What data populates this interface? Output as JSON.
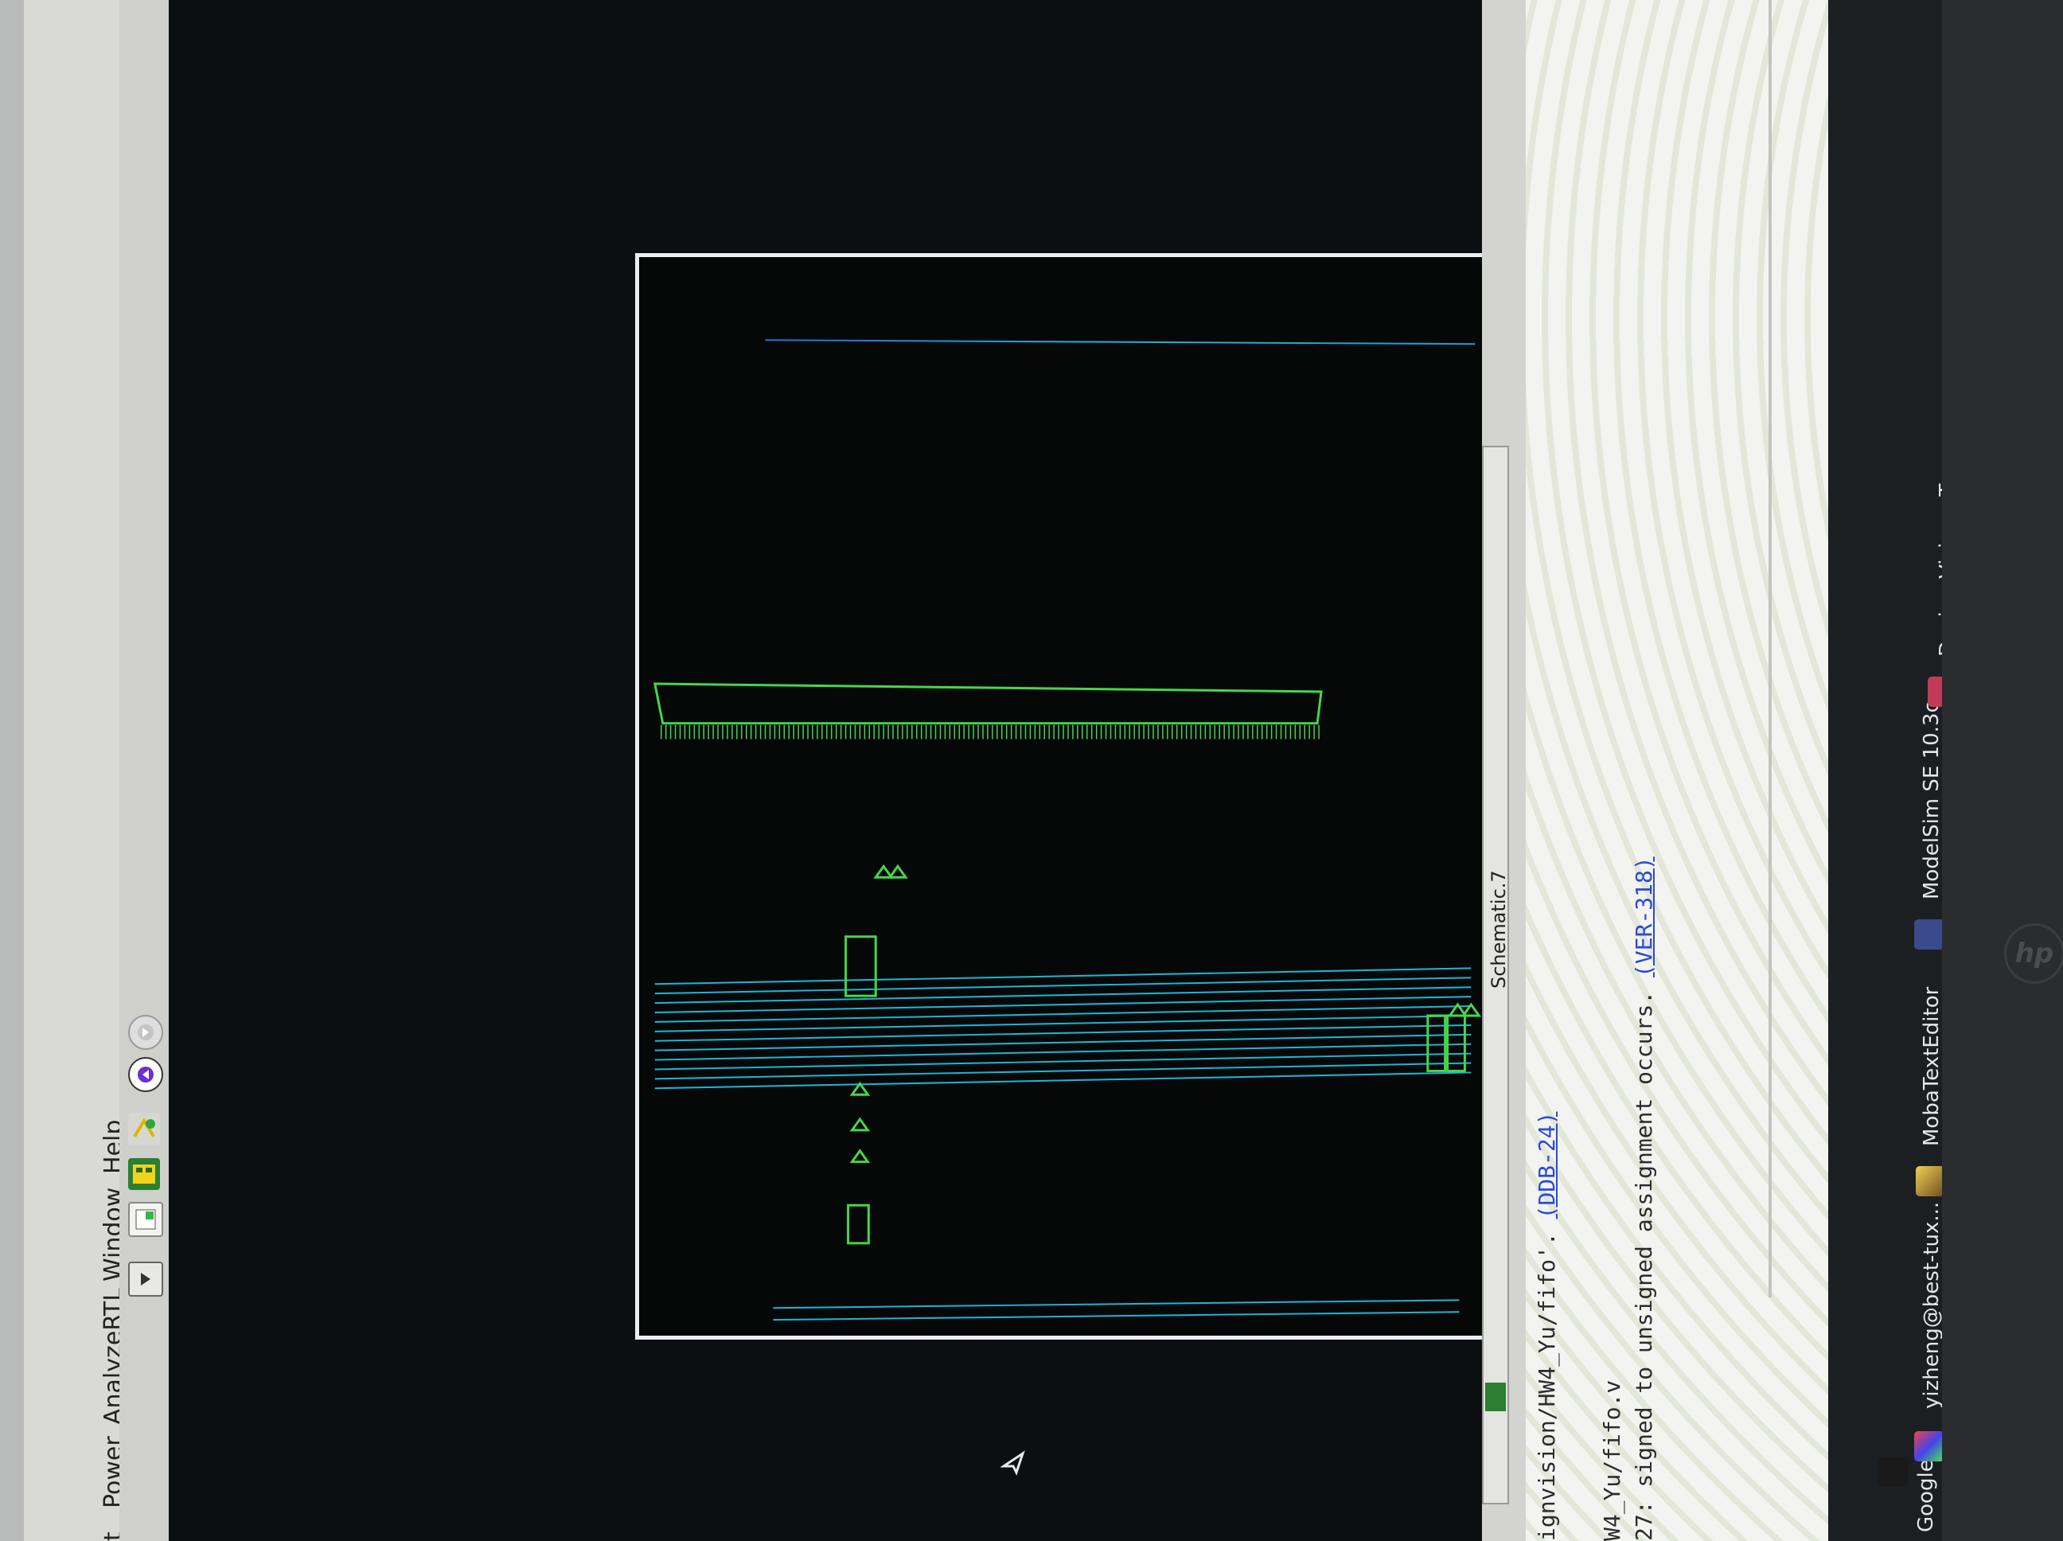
{
  "menu": {
    "items": [
      "t",
      "Power",
      "AnalyzeRTL",
      "Window",
      "Help"
    ]
  },
  "toolbar": {
    "icons": [
      "dropdown-icon",
      "window-icon",
      "debug-icon",
      "trace-icon",
      "prev-icon",
      "next-icon"
    ]
  },
  "schematic": {
    "tab_label": "Schematic.7"
  },
  "console": {
    "line1_prefix": "ignvision/HW4_Yu/fifo'.",
    "line1_link": "(DDB-24)",
    "line2": "W4_Yu/fifo.v",
    "line3_prefix": "27: signed to unsigned assignment occurs.",
    "line3_link": "(VER-318)"
  },
  "taskbar": {
    "items": [
      {
        "label": "Google ...",
        "icon": "chrome-icon"
      },
      {
        "label": "yizheng@best-tux...",
        "icon": "terminal-icon"
      },
      {
        "label": "MobaTextEditor",
        "icon": "editor-icon"
      },
      {
        "label": "ModelSim SE 10.3c",
        "icon": "modelsim-icon"
      },
      {
        "label": "Design Vision - Top...",
        "icon": "design-vision-icon"
      }
    ]
  },
  "brand": {
    "logo_text": "hp"
  },
  "colors": {
    "wire_blue": "#1e9be0",
    "wire_teal": "#19c9c0",
    "cell_green": "#46d64b",
    "canvas_bg": "#0c0f12",
    "frame_white": "#e9eef2",
    "link_blue": "#2a4ad8"
  }
}
